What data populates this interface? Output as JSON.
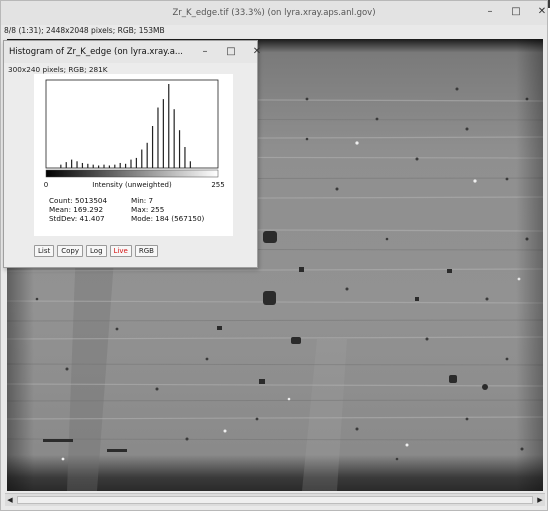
{
  "main_window": {
    "title": "Zr_K_edge.tif (33.3%) (on lyra.xray.aps.anl.gov)",
    "info": "8/8 (1:31); 2448x2048 pixels; RGB; 153MB",
    "minimize_glyph": "–",
    "maximize_glyph": "□",
    "close_glyph": "✕",
    "scroll_left": "◀",
    "scroll_right": "▶"
  },
  "histogram_window": {
    "title": "Histogram of Zr_K_edge (on lyra.xray.a...",
    "info": "300x240 pixels; RGB; 281K",
    "minimize_glyph": "–",
    "maximize_glyph": "□",
    "close_glyph": "✕",
    "axis_min": "0",
    "axis_max": "255",
    "axis_label": "Intensity (unweighted)",
    "stats": {
      "count": "Count: 5013504",
      "mean": "Mean: 169.292",
      "stddev": "StdDev: 41.407",
      "min": "Min: 7",
      "max": "Max: 255",
      "mode": "Mode: 184 (567150)"
    },
    "buttons": {
      "list": "List",
      "copy": "Copy",
      "log": "Log",
      "live": "Live",
      "rgb": "RGB"
    }
  },
  "chart_data": {
    "type": "bar",
    "title": "",
    "xlabel": "Intensity (unweighted)",
    "ylabel": "",
    "xlim": [
      0,
      255
    ],
    "ylim": [
      0,
      100
    ],
    "x": [
      22,
      30,
      38,
      46,
      54,
      62,
      70,
      78,
      86,
      94,
      102,
      110,
      118,
      126,
      134,
      142,
      150,
      158,
      166,
      174,
      182,
      190,
      198,
      206,
      214
    ],
    "values": [
      4,
      7,
      10,
      8,
      6,
      5,
      4,
      3,
      4,
      3,
      4,
      6,
      5,
      10,
      12,
      22,
      30,
      50,
      72,
      82,
      100,
      70,
      45,
      25,
      8
    ],
    "counts": {
      "count": 5013504,
      "mean": 169.292,
      "stddev": 41.407,
      "min": 7,
      "max": 255,
      "mode": 184,
      "mode_count": 567150
    }
  },
  "colors": {
    "live_text": "#d41414",
    "panel_bg": "#ffffff",
    "window_bg": "#ececec"
  }
}
